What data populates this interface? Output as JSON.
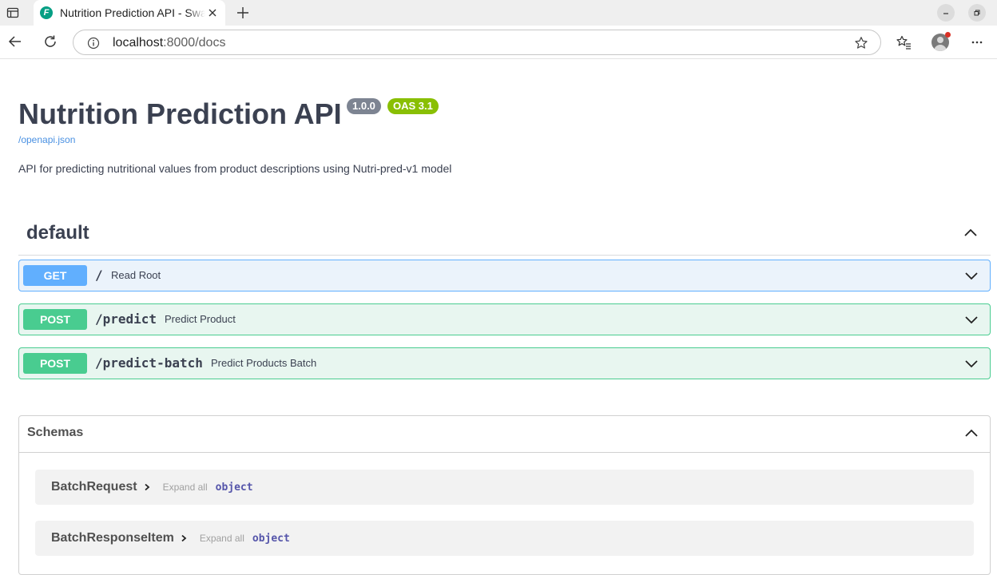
{
  "browser": {
    "tab_title": "Nutrition Prediction API - Swagger UI",
    "favicon_letter": "F",
    "url_host": "localhost",
    "url_rest": ":8000/docs",
    "icons": [
      "sidebar-icon",
      "close-icon",
      "plus-icon",
      "minimize-icon",
      "restore-icon",
      "back-icon",
      "reload-icon",
      "info-icon",
      "star-icon",
      "favorites-icon",
      "profile-icon",
      "more-icon"
    ]
  },
  "info": {
    "title": "Nutrition Prediction API",
    "version": "1.0.0",
    "oas": "OAS 3.1",
    "spec_link": "/openapi.json",
    "description": "API for predicting nutritional values from product descriptions using Nutri-pred-v1 model"
  },
  "tag": {
    "name": "default",
    "operations": [
      {
        "method": "GET",
        "path": "/",
        "summary": "Read Root"
      },
      {
        "method": "POST",
        "path": "/predict",
        "summary": "Predict Product"
      },
      {
        "method": "POST",
        "path": "/predict-batch",
        "summary": "Predict Products Batch"
      }
    ]
  },
  "schemas": {
    "title": "Schemas",
    "expand_label": "Expand all",
    "models": [
      {
        "name": "BatchRequest",
        "type": "object"
      },
      {
        "name": "BatchResponseItem",
        "type": "object"
      }
    ]
  },
  "colors": {
    "get": "#61affe",
    "post": "#49cc90",
    "text": "#3b4151",
    "link": "#4990e2",
    "version_badge": "#7d8492",
    "oas_badge": "#89bf04"
  }
}
